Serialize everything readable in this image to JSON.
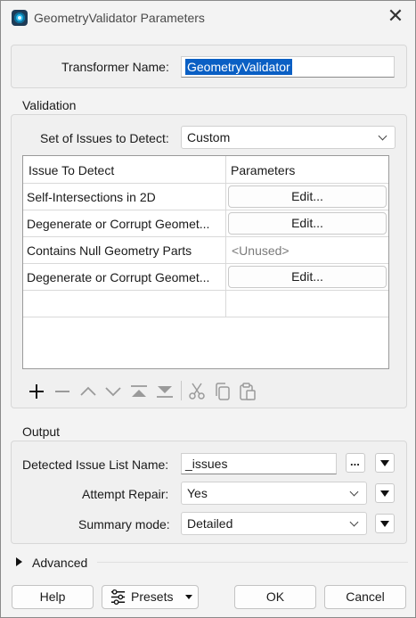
{
  "window": {
    "title": "GeometryValidator Parameters"
  },
  "transformer": {
    "label": "Transformer Name:",
    "value": "GeometryValidator"
  },
  "validation": {
    "title": "Validation",
    "issues_label": "Set of Issues to Detect:",
    "issues_value": "Custom",
    "table": {
      "headers": [
        "Issue To Detect",
        "Parameters"
      ],
      "rows": [
        {
          "issue": "Self-Intersections in 2D",
          "param": "Edit..."
        },
        {
          "issue": "Degenerate or Corrupt Geomet...",
          "param": "Edit..."
        },
        {
          "issue": "Contains Null Geometry Parts",
          "param": "<Unused>"
        },
        {
          "issue": "Degenerate or Corrupt Geomet...",
          "param": "Edit..."
        }
      ]
    }
  },
  "output": {
    "title": "Output",
    "list_label": "Detected Issue List Name:",
    "list_value": "_issues",
    "browse_label": "...",
    "repair_label": "Attempt Repair:",
    "repair_value": "Yes",
    "summary_label": "Summary mode:",
    "summary_value": "Detailed"
  },
  "advanced": {
    "label": "Advanced"
  },
  "footer": {
    "help": "Help",
    "presets": "Presets",
    "ok": "OK",
    "cancel": "Cancel"
  }
}
